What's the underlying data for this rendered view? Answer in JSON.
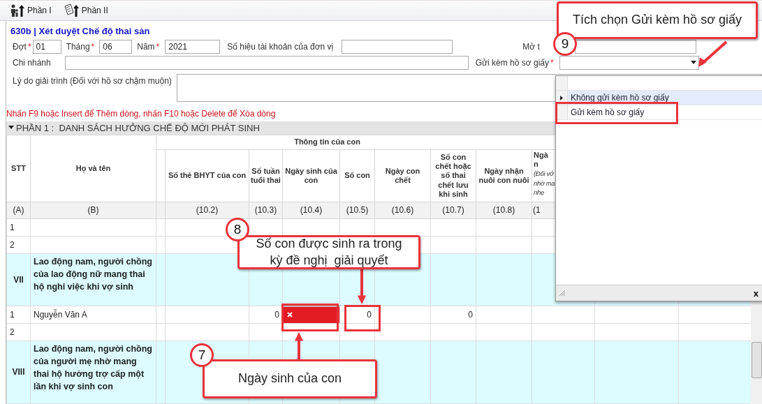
{
  "toolbar": [
    {
      "label": "Phần I",
      "kind": "people"
    },
    {
      "label": "Phần II",
      "kind": "document"
    }
  ],
  "form": {
    "title": "630b | Xét duyệt Chế độ thai sản",
    "required_mark": "*",
    "row_1": [
      {
        "label": "Đợt",
        "required": true,
        "value": "01"
      },
      {
        "label": "Tháng",
        "required": true,
        "value": "06"
      },
      {
        "label": "Năm",
        "required": true,
        "value": "2021"
      },
      {
        "label": "Số hiệu tài khoản của đơn vị",
        "required": false
      },
      {
        "label": "Mở t",
        "required": false
      }
    ],
    "branch": {
      "label": "Chi nhánh"
    },
    "paper": {
      "label": "Gửi kèm hồ sơ giấy",
      "required": true
    },
    "reason": {
      "label": "Lý do giải trình (Đối với hồ sơ chậm muộn)"
    },
    "hint": "Nhấn F9 hoặc Insert để Thêm dòng, nhấn F10 hoặc Delete để Xóa dòng"
  },
  "dropdown": {
    "options": [
      {
        "label": "Không gửi kèm hồ sơ giấy",
        "selected": true
      },
      {
        "label": "Gửi kèm hồ sơ giấy",
        "selected": false
      }
    ],
    "close": "x"
  },
  "section": {
    "title": "PHẦN 1 :  DANH SÁCH HƯỞNG CHẾ ĐỘ MỚI PHÁT SINH",
    "expanded": true
  },
  "table": {
    "stt_header": "STT",
    "name_header": "Họ và tên",
    "group_header": "Thông tin của con",
    "stt_index": "(A)",
    "name_index": "(B)",
    "columns": [
      {
        "label": "Số thẻ BHYT của con",
        "index": "(10.2)"
      },
      {
        "label": "Số tuần tuổi thai",
        "index": "(10.3)"
      },
      {
        "label": "Ngày sinh của con",
        "index": "(10.4)"
      },
      {
        "label": "Số con",
        "index": "(10.5)"
      },
      {
        "label": "Ngày con chết",
        "index": "(10.6)"
      },
      {
        "label": "Số con chết hoặc số thai chết lưu khi sinh",
        "index": "(10.7)"
      },
      {
        "label": "Ngày nhận nuôi con nuôi",
        "index": "(10.8)"
      },
      {
        "label": "Ngà\nn",
        "note": "(Đối vớ\nnhờ ma\nnhẹ",
        "index": "(1"
      }
    ],
    "rows": [
      {
        "kind": "item",
        "stt": "1"
      },
      {
        "kind": "item",
        "stt": "2"
      },
      {
        "kind": "group",
        "stt": "VII",
        "name": "Lao động nam, người chồng của lao động nữ mang thai hộ nghỉ việc khi vợ sinh"
      },
      {
        "kind": "item",
        "stt": "1",
        "name": "Nguyễn Văn A",
        "cells": [
          {
            "kind": "blank"
          },
          {
            "kind": "number",
            "text": "0"
          },
          {
            "kind": "error"
          },
          {
            "kind": "number",
            "text": "0"
          },
          {
            "kind": "blank"
          },
          {
            "kind": "number",
            "text": "0"
          },
          {
            "kind": "blank"
          },
          {
            "kind": "blank"
          }
        ]
      },
      {
        "kind": "item",
        "stt": "2"
      },
      {
        "kind": "group",
        "stt": "VIII",
        "name": "Lao động nam, người chồng của người mẹ nhờ mang thai hộ hưởng trợ cấp một lần khi vợ sinh con"
      }
    ]
  },
  "annotations": [
    {
      "number": "9",
      "text": "Tích chọn Gửi kèm hồ sơ giấy"
    },
    {
      "number": "8",
      "text": "Số con được sinh ra trong kỳ đề nghị  giải quyết"
    },
    {
      "number": "7",
      "text": "Ngày sinh của con"
    }
  ]
}
